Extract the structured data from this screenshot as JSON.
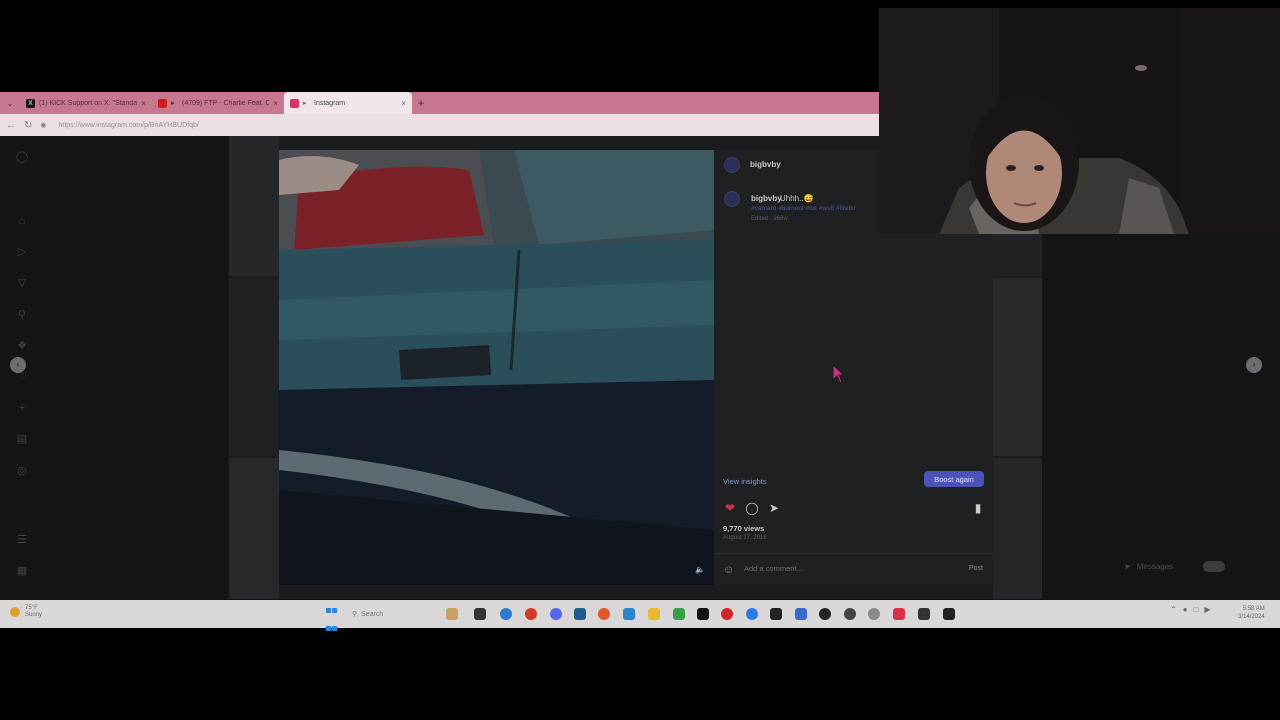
{
  "browser": {
    "tabs": [
      {
        "title": "(1) KICK Support on X: \"Standards",
        "favicon": "x-logo-icon",
        "color": "#111111"
      },
      {
        "title": "(4709) FTP - Charlie Feat. Obx",
        "favicon": "youtube-icon",
        "color": "#cc1f1f"
      },
      {
        "title": "Instagram",
        "favicon": "instagram-icon",
        "color": "#d6336c",
        "active": true
      }
    ],
    "url": "https://www.instagram.com/p/BnAYHBUDfqb/"
  },
  "post": {
    "username": "bigbvby",
    "caption_user": "bigbvby",
    "caption_text": "Uhhh..😅",
    "hashtags": "#camaro #burnout #lsx #ws6 #firebir",
    "edited": "Edited · 366w",
    "view_insights": "View insights",
    "boost_label": "Boost again",
    "views": "9,770 views",
    "date": "August 27, 2018",
    "comment_placeholder": "Add a comment...",
    "post_label": "Post",
    "liked": true
  },
  "messages": {
    "label": "Messages"
  },
  "taskbar": {
    "weather_temp": "75°F",
    "weather_desc": "Sunny",
    "search_placeholder": "Search",
    "time": "5:58 AM",
    "date": "3/14/2024"
  },
  "colors": {
    "accent": "#4b52b8",
    "like": "#c8324a",
    "tabbar": "#c7788f"
  }
}
